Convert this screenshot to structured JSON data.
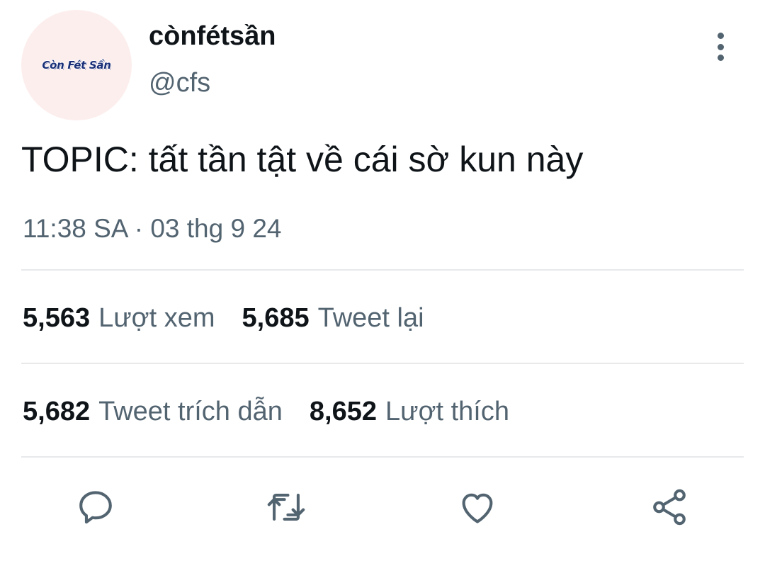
{
  "author": {
    "display_name": "cònfétsần",
    "handle": "@cfs",
    "avatar_text": "Còn Fét Sần"
  },
  "tweet": {
    "text": "TOPIC: tất tần tật về cái sờ kun này",
    "timestamp": "11:38 SA · 03 thg 9 24"
  },
  "stats": {
    "views": {
      "count": "5,563",
      "label": "Lượt xem"
    },
    "retweets": {
      "count": "5,685",
      "label": "Tweet lại"
    },
    "quotes": {
      "count": "5,682",
      "label": "Tweet trích dẫn"
    },
    "likes": {
      "count": "8,652",
      "label": "Lượt thích"
    }
  },
  "actions": [
    {
      "name": "reply",
      "icon": "comment-icon"
    },
    {
      "name": "retweet",
      "icon": "retweet-icon"
    },
    {
      "name": "like",
      "icon": "heart-icon"
    },
    {
      "name": "share",
      "icon": "share-icon"
    }
  ],
  "colors": {
    "text_primary": "#0f1419",
    "text_secondary": "#536471",
    "divider": "#e7e9ea",
    "avatar_bg": "#fdeeee"
  }
}
